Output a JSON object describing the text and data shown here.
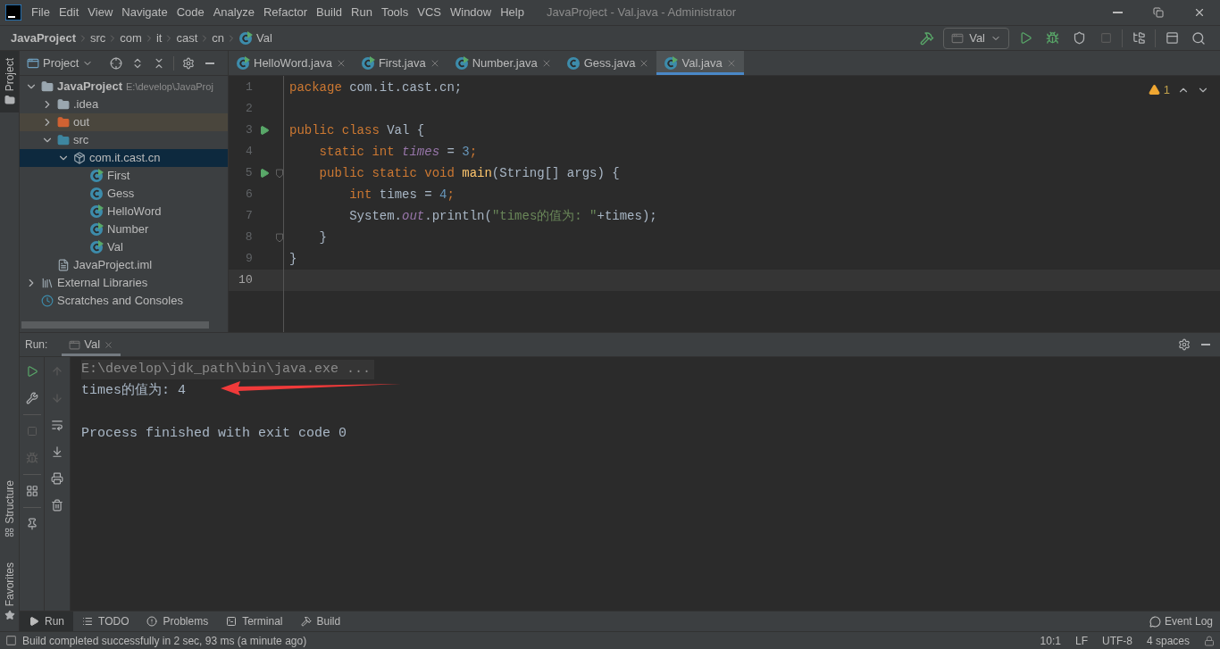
{
  "menu": [
    "File",
    "Edit",
    "View",
    "Navigate",
    "Code",
    "Analyze",
    "Refactor",
    "Build",
    "Run",
    "Tools",
    "VCS",
    "Window",
    "Help"
  ],
  "window": {
    "title": "JavaProject - Val.java - Administrator"
  },
  "breadcrumbs": [
    {
      "label": "JavaProject",
      "kind": "project"
    },
    {
      "label": "src",
      "kind": "dir"
    },
    {
      "label": "com",
      "kind": "dir"
    },
    {
      "label": "it",
      "kind": "dir"
    },
    {
      "label": "cast",
      "kind": "dir"
    },
    {
      "label": "cn",
      "kind": "dir"
    },
    {
      "label": "Val",
      "kind": "class"
    }
  ],
  "run_config": "Val",
  "side_tabs_left_top": [
    {
      "label": "Project",
      "selected": true
    }
  ],
  "side_tabs_left_bottom": [
    {
      "label": "Structure",
      "selected": false
    },
    {
      "label": "Favorites",
      "selected": false
    }
  ],
  "project_panel": {
    "title": "Project",
    "tree": [
      {
        "label": "JavaProject",
        "path": "E:\\develop\\JavaProj",
        "kind": "project",
        "expanded": true,
        "selected": false,
        "children": [
          {
            "label": ".idea",
            "kind": "folder",
            "expanded": false,
            "selected": false
          },
          {
            "label": "out",
            "kind": "excluded",
            "expanded": false,
            "selected": false
          },
          {
            "label": "src",
            "kind": "source",
            "expanded": true,
            "selected": false,
            "children": [
              {
                "label": "com.it.cast.cn",
                "kind": "package",
                "expanded": true,
                "selected": true,
                "children": [
                  {
                    "label": "First",
                    "kind": "class",
                    "runnable": true,
                    "selected": false
                  },
                  {
                    "label": "Gess",
                    "kind": "class",
                    "runnable": false,
                    "selected": false
                  },
                  {
                    "label": "HelloWord",
                    "kind": "class",
                    "runnable": true,
                    "selected": false
                  },
                  {
                    "label": "Number",
                    "kind": "class",
                    "runnable": true,
                    "selected": false
                  },
                  {
                    "label": "Val",
                    "kind": "class",
                    "runnable": true,
                    "selected": false
                  }
                ]
              }
            ]
          },
          {
            "label": "JavaProject.iml",
            "kind": "file",
            "selected": false
          }
        ]
      },
      {
        "label": "External Libraries",
        "kind": "libraries",
        "expanded": false,
        "selected": false
      },
      {
        "label": "Scratches and Consoles",
        "kind": "scratches",
        "selected": false
      }
    ]
  },
  "editor_tabs": [
    {
      "label": "HelloWord.java",
      "selected": false
    },
    {
      "label": "First.java",
      "selected": false
    },
    {
      "label": "Number.java",
      "selected": false
    },
    {
      "label": "Gess.java",
      "selected": false
    },
    {
      "label": "Val.java",
      "selected": true
    }
  ],
  "warnings": "1",
  "code": [
    {
      "number": "1",
      "run": false,
      "fold": false,
      "current": false,
      "tokens": [
        {
          "kind": "keyword",
          "text": "package"
        },
        {
          "kind": "plain",
          "text": " com.it.cast.cn;"
        }
      ]
    },
    {
      "number": "2",
      "run": false,
      "fold": false,
      "current": false
    },
    {
      "number": "3",
      "run": true,
      "fold": false,
      "current": false,
      "tokens": [
        {
          "kind": "keyword",
          "text": "public class "
        },
        {
          "kind": "plain",
          "text": "Val {"
        }
      ]
    },
    {
      "number": "4",
      "run": false,
      "fold": false,
      "current": false,
      "tokens": [
        {
          "kind": "keyword",
          "text": "    static int "
        },
        {
          "kind": "field",
          "text": "times"
        },
        {
          "kind": "plain",
          "text": " = "
        },
        {
          "kind": "number",
          "text": "3"
        },
        {
          "kind": "keyword",
          "text": ";"
        }
      ]
    },
    {
      "number": "5",
      "run": true,
      "fold": true,
      "current": false,
      "tokens": [
        {
          "kind": "keyword",
          "text": "    public static void "
        },
        {
          "kind": "method",
          "text": "main"
        },
        {
          "kind": "plain",
          "text": "(String[] args) {"
        }
      ]
    },
    {
      "number": "6",
      "run": false,
      "fold": false,
      "current": false,
      "tokens": [
        {
          "kind": "keyword",
          "text": "        int "
        },
        {
          "kind": "plain",
          "text": "times = "
        },
        {
          "kind": "number",
          "text": "4"
        },
        {
          "kind": "keyword",
          "text": ";"
        }
      ]
    },
    {
      "number": "7",
      "run": false,
      "fold": false,
      "current": false,
      "tokens": [
        {
          "kind": "plain",
          "text": "        System."
        },
        {
          "kind": "field",
          "text": "out"
        },
        {
          "kind": "plain",
          "text": ".println("
        },
        {
          "kind": "string",
          "text": "\"times的值为: \""
        },
        {
          "kind": "plain",
          "text": "+times);"
        }
      ]
    },
    {
      "number": "8",
      "run": false,
      "fold": true,
      "current": false,
      "tokens": [
        {
          "kind": "plain",
          "text": "    }"
        }
      ]
    },
    {
      "number": "9",
      "run": false,
      "fold": false,
      "current": false,
      "tokens": [
        {
          "kind": "plain",
          "text": "}"
        }
      ]
    },
    {
      "number": "10",
      "run": false,
      "fold": false,
      "current": true
    }
  ],
  "run_panel": {
    "label": "Run:",
    "tabs": [
      {
        "label": "Val",
        "selected": true
      }
    ],
    "console": [
      {
        "kind": "command",
        "text": "E:\\develop\\jdk_path\\bin\\java.exe ..."
      },
      {
        "kind": "output",
        "text": "times的值为: 4"
      },
      {
        "kind": "exit",
        "text": "Process finished with exit code 0"
      }
    ]
  },
  "tool_tabs": [
    {
      "label": "Run",
      "kind": "run",
      "selected": true
    },
    {
      "label": "TODO",
      "kind": "todo",
      "selected": false
    },
    {
      "label": "Problems",
      "kind": "problems",
      "selected": false
    },
    {
      "label": "Terminal",
      "kind": "terminal",
      "selected": false
    },
    {
      "label": "Build",
      "kind": "build",
      "selected": false
    }
  ],
  "event_log": "Event Log",
  "status_bar": {
    "message": "Build completed successfully in 2 sec, 93 ms (a minute ago)",
    "items": [
      "10:1",
      "LF",
      "UTF-8",
      "4 spaces"
    ]
  }
}
